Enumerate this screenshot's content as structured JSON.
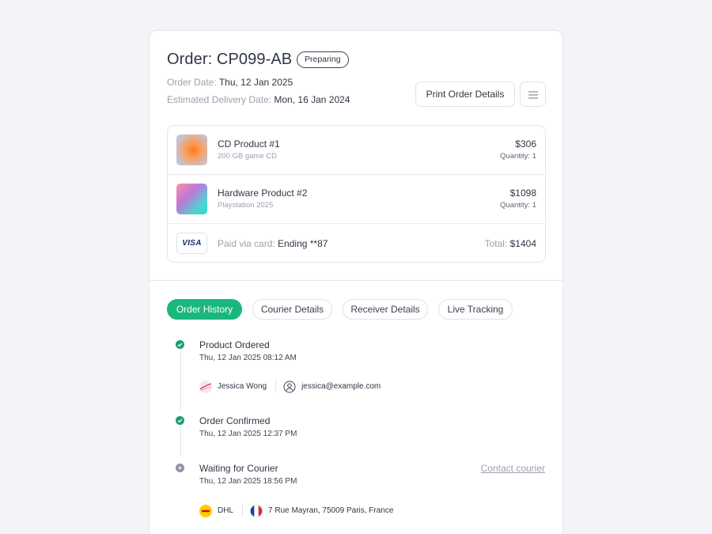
{
  "order": {
    "title": "Order: CP099-AB",
    "status": "Preparing",
    "date_label": "Order Date:",
    "date_value": "Thu, 12 Jan 2025",
    "eta_label": "Estimated Delivery Date:",
    "eta_value": "Mon, 16 Jan 2024"
  },
  "actions": {
    "print_label": "Print Order Details",
    "menu_icon": "menu-icon"
  },
  "items": [
    {
      "name": "CD Product #1",
      "desc": "200 GB game CD",
      "price": "$306",
      "qty": "Quantity: 1"
    },
    {
      "name": "Hardware Product #2",
      "desc": "Playstation 2025",
      "price": "$1098",
      "qty": "Quantity: 1"
    }
  ],
  "payment": {
    "brand": "VISA",
    "label": "Paid via card:",
    "card": "Ending **87",
    "total_label": "Total:",
    "total_value": "$1404"
  },
  "tabs": [
    {
      "label": "Order History",
      "active": true
    },
    {
      "label": "Courier Details",
      "active": false
    },
    {
      "label": "Receiver Details",
      "active": false
    },
    {
      "label": "Live Tracking",
      "active": false
    }
  ],
  "history": [
    {
      "title": "Product Ordered",
      "time": "Thu, 12 Jan 2025  08:12 AM",
      "status": "done",
      "person": "Jessica Wong",
      "email": "jessica@example.com"
    },
    {
      "title": "Order Confirmed",
      "time": "Thu, 12 Jan 2025  12:37 PM",
      "status": "done"
    },
    {
      "title": "Waiting for Courier",
      "time": "Thu, 12 Jan 2025  18:56 PM",
      "status": "pending",
      "action": "Contact courier",
      "courier": "DHL",
      "address": "7 Rue Mayran, 75009 Paris, France"
    }
  ],
  "colors": {
    "accent": "#1ab77c",
    "done": "#1a9e6a",
    "pending": "#8f96a3"
  }
}
